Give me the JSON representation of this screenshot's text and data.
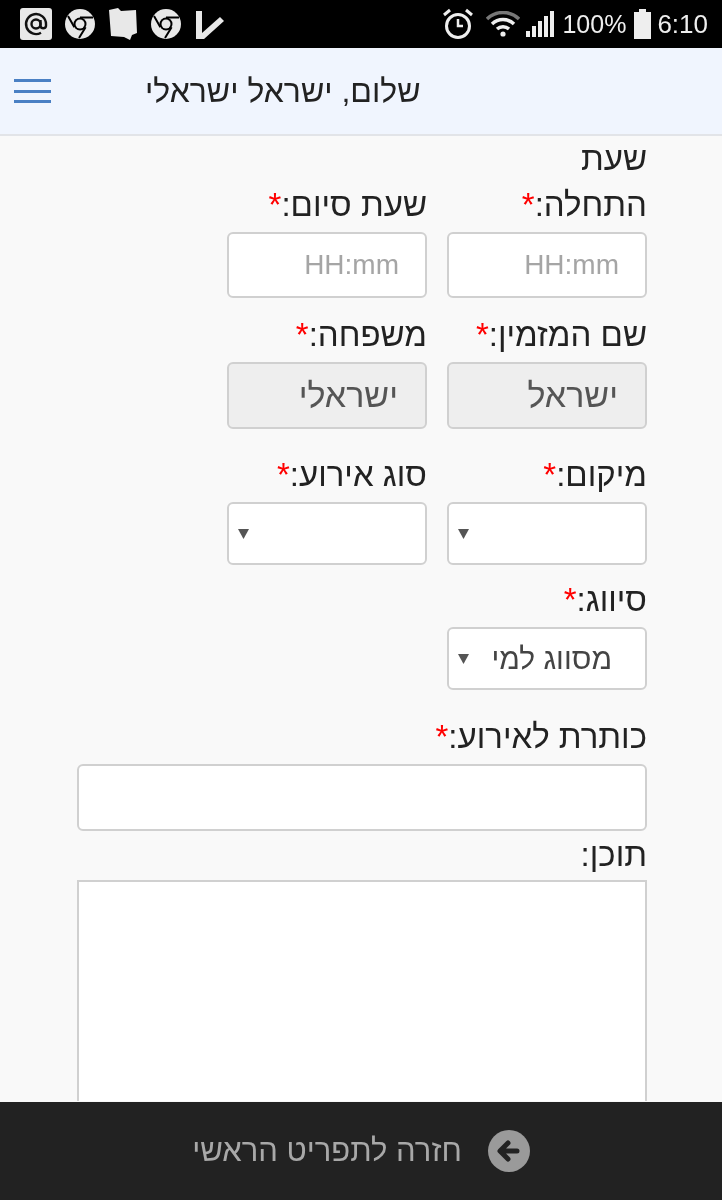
{
  "status_bar": {
    "battery": "100%",
    "time": "6:10"
  },
  "header": {
    "title": "שלום, ישראל ישראלי"
  },
  "form": {
    "rows": [
      {
        "fields": [
          {
            "kind": "time",
            "label": "שעת התחלה:",
            "required_mark": "*",
            "placeholder": "HH:mm"
          },
          {
            "kind": "time",
            "label": "שעת סיום:",
            "required_mark": "*",
            "placeholder": "HH:mm"
          }
        ]
      },
      {
        "fields": [
          {
            "kind": "readonly",
            "label": "שם המזמין:",
            "required_mark": "*",
            "value": "ישראל"
          },
          {
            "kind": "readonly",
            "label": "משפחה:",
            "required_mark": "*",
            "value": "ישראלי"
          }
        ]
      },
      {
        "fields": [
          {
            "kind": "select",
            "label": "מיקום:",
            "required_mark": "*"
          },
          {
            "kind": "select",
            "label": "סוג אירוע:",
            "required_mark": "*"
          }
        ]
      },
      {
        "fields": [
          {
            "kind": "select",
            "label": "סיווג:",
            "required_mark": "*",
            "value": "מסווג למי"
          }
        ]
      },
      {
        "fields": [
          {
            "kind": "text",
            "label": "כותרת לאירוע:",
            "required_mark": "*"
          }
        ]
      },
      {
        "fields": [
          {
            "kind": "textarea",
            "label": "תוכן:"
          }
        ]
      }
    ]
  },
  "footer": {
    "button": "חזרה לתפריט הראשי"
  }
}
